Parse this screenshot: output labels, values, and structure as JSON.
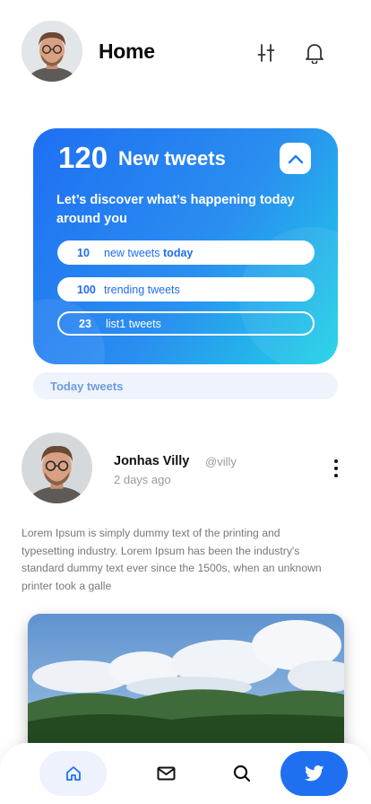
{
  "header": {
    "title": "Home",
    "avatar_icon": "profile-photo",
    "filter_icon": "sliders-icon",
    "notification_icon": "bell-icon"
  },
  "hero": {
    "count": "120",
    "title": "New tweets",
    "subtitle": "Let’s discover what’s happening  today around you",
    "gradient": [
      "#1f6ff2",
      "#1fd2e6"
    ],
    "collapse_icon": "chevron-up-icon",
    "stats": [
      {
        "count": "10",
        "label": "new tweets ",
        "label_bold": "today",
        "style": "filled"
      },
      {
        "count": "100",
        "label": "trending tweets",
        "label_bold": "",
        "style": "filled"
      },
      {
        "count": "23",
        "label": "list1 tweets",
        "label_bold": "",
        "style": "outline"
      }
    ]
  },
  "section_tab": {
    "label": "Today tweets"
  },
  "post": {
    "author": "Jonhas Villy",
    "handle": "@villy",
    "time": "2 days ago",
    "text": "Lorem Ipsum is simply dummy text of the printing and typesetting industry. Lorem Ipsum has been the industry's standard dummy text ever since the 1500s, when an unknown printer took a galle",
    "more_icon": "more-vertical-icon",
    "image": "landscape-photo"
  },
  "bottom_nav": {
    "items": [
      {
        "icon": "home-icon",
        "active": true
      },
      {
        "icon": "mail-icon",
        "active": false
      },
      {
        "icon": "search-icon",
        "active": false
      },
      {
        "icon": "twitter-bird-icon",
        "active": false
      }
    ],
    "accent": "#1f70f0"
  }
}
